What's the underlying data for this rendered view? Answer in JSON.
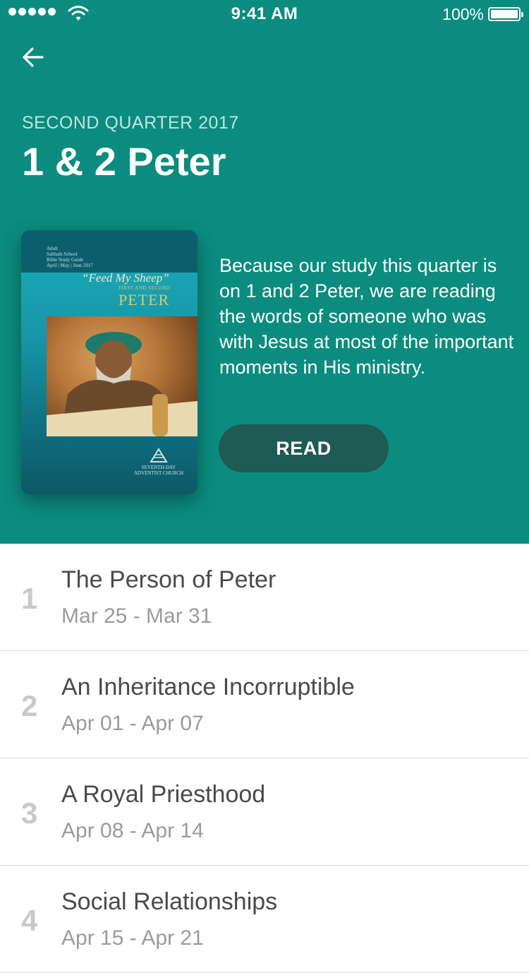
{
  "status_bar": {
    "time": "9:41 AM",
    "battery": "100%",
    "icons": [
      "signal-dots-icon",
      "wifi-icon",
      "battery-icon"
    ]
  },
  "nav": {
    "back_icon": "arrow-left-icon"
  },
  "quarter": {
    "label": "SECOND QUARTER 2017",
    "title": "1 & 2 Peter",
    "description": "Because our study this quarter is on 1 and 2 Peter, we are reading the words of someone who was with Jesus at most of the important moments in His ministry.",
    "read_label": "READ"
  },
  "cover": {
    "line1": "Adult",
    "line2": "Sabbath School",
    "line3": "Bible Study Guide",
    "line4": "April | May | June 2017",
    "feed": "“Feed My Sheep”",
    "first_second": "FIRST AND SECOND",
    "peter": "PETER",
    "logo_line1": "SEVENTH-DAY",
    "logo_line2": "ADVENTIST CHURCH"
  },
  "lessons": [
    {
      "number": "1",
      "title": "The Person of Peter",
      "dates": "Mar 25 - Mar 31"
    },
    {
      "number": "2",
      "title": "An Inheritance Incorruptible",
      "dates": "Apr 01 - Apr 07"
    },
    {
      "number": "3",
      "title": "A Royal Priesthood",
      "dates": "Apr 08 - Apr 14"
    },
    {
      "number": "4",
      "title": "Social Relationships",
      "dates": "Apr 15 - Apr 21"
    }
  ],
  "colors": {
    "header_bg": "#0b8c7f",
    "read_button_bg": "#1f5a55",
    "lesson_number": "#c9c9c9",
    "lesson_title": "#4a4a4a",
    "lesson_dates": "#9b9b9b"
  }
}
